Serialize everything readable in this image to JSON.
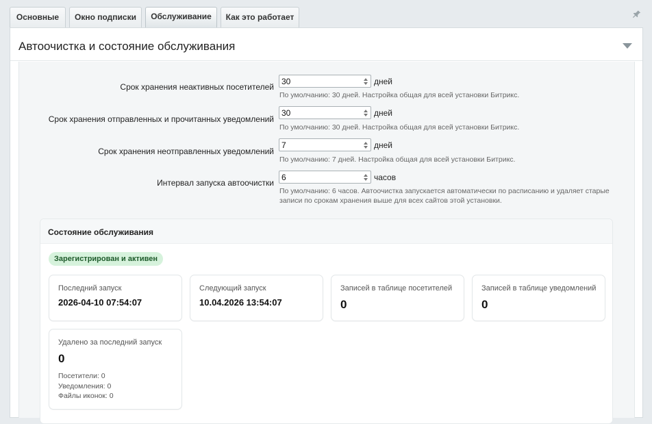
{
  "tabs": [
    {
      "label": "Основные"
    },
    {
      "label": "Окно подписки"
    },
    {
      "label": "Обслуживание"
    },
    {
      "label": "Как это работает"
    }
  ],
  "active_tab": "Обслуживание",
  "section": {
    "title": "Автоочистка и состояние обслуживания"
  },
  "settings": [
    {
      "label": "Срок хранения неактивных посетителей",
      "value": "30",
      "unit": "дней",
      "hint": "По умолчанию: 30 дней. Настройка общая для всей установки Битрикс."
    },
    {
      "label": "Срок хранения отправленных и прочитанных уведомлений",
      "value": "30",
      "unit": "дней",
      "hint": "По умолчанию: 30 дней. Настройка общая для всей установки Битрикс."
    },
    {
      "label": "Срок хранения неотправленных уведомлений",
      "value": "7",
      "unit": "дней",
      "hint": "По умолчанию: 7 дней. Настройка общая для всей установки Битрикс."
    },
    {
      "label": "Интервал запуска автоочистки",
      "value": "6",
      "unit": "часов",
      "hint": "По умолчанию: 6 часов. Автоочистка запускается автоматически по расписанию и удаляет старые записи по срокам хранения выше для всех сайтов этой установки."
    }
  ],
  "status": {
    "title": "Состояние обслуживания",
    "badge": "Зарегистрирован и активен",
    "badge_color": "#d6f2dc",
    "cards": [
      {
        "label": "Последний запуск",
        "value": "2026-04-10 07:54:07"
      },
      {
        "label": "Следующий запуск",
        "value": "10.04.2026 13:54:07"
      },
      {
        "label": "Записей в таблице посетителей",
        "value": "0"
      },
      {
        "label": "Записей в таблице уведомлений",
        "value": "0"
      }
    ],
    "deleted": {
      "label": "Удалено за последний запуск",
      "value": "0",
      "details": [
        "Посетители: 0",
        "Уведомления: 0",
        "Файлы иконок: 0"
      ]
    }
  },
  "icons": {
    "pin": "pin-icon",
    "collapse": "chevron-down-icon"
  }
}
